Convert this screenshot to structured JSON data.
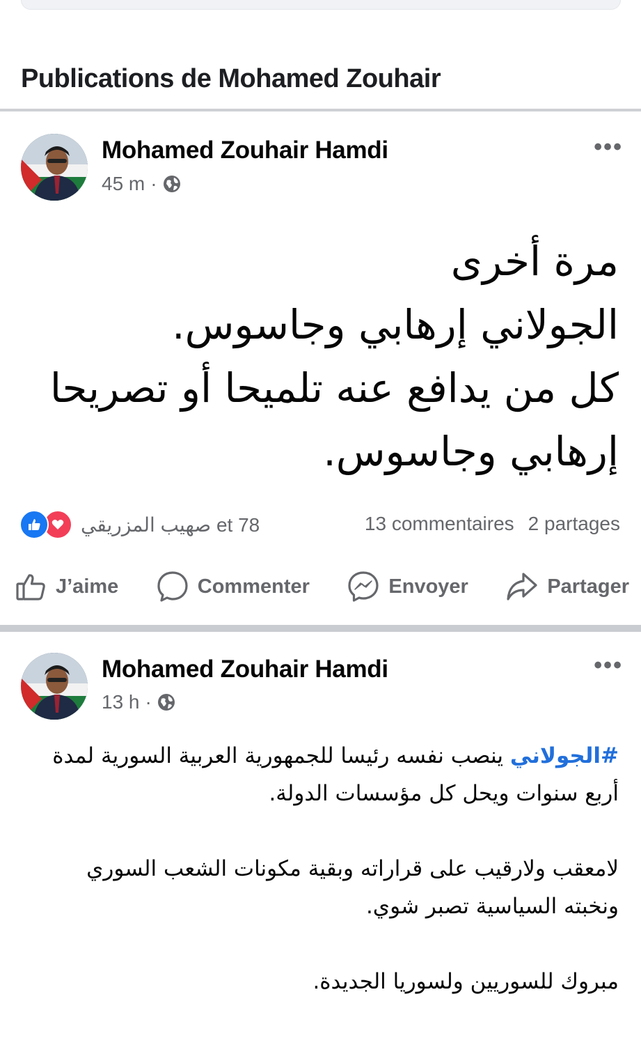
{
  "section": {
    "title": "Publications de Mohamed Zouhair"
  },
  "post1": {
    "author": "Mohamed Zouhair Hamdi",
    "time": "45 m",
    "separator": "·",
    "more_label": "•••",
    "lines": [
      "مرة أخرى",
      "الجولاني إرهابي وجاسوس.",
      "كل من يدافع عنه تلميحا أو تصريحا",
      "إرهابي وجاسوس."
    ],
    "reactions_text": "صهيب المزريقي et 78",
    "comments": "13 commentaires",
    "shares": "2 partages",
    "actions": {
      "like": "J’aime",
      "comment": "Commenter",
      "send": "Envoyer",
      "share": "Partager"
    }
  },
  "post2": {
    "author": "Mohamed Zouhair Hamdi",
    "time": "13 h",
    "separator": "·",
    "more_label": "•••",
    "hashtag": "#الجولاني",
    "para1_rest": " ينصب نفسه رئيسا للجمهورية العربية السورية لمدة أربع سنوات ويحل كل مؤسسات الدولة.",
    "para2": "لامعقب ولارقيب على قراراته وبقية مكونات الشعب السوري ونخبته السياسية تصبر شوي.",
    "para3": "مبروك للسوريين ولسوريا الجديدة."
  },
  "icons": {
    "avatar": "profile-photo",
    "globe": "globe-icon",
    "like": "thumbs-up-icon",
    "comment": "comment-bubble-icon",
    "send": "messenger-icon",
    "share": "share-arrow-icon"
  },
  "colors": {
    "link": "#216fdb",
    "like_blue": "#1877f2",
    "love_red": "#f33e58",
    "secondary_text": "#65676b"
  }
}
